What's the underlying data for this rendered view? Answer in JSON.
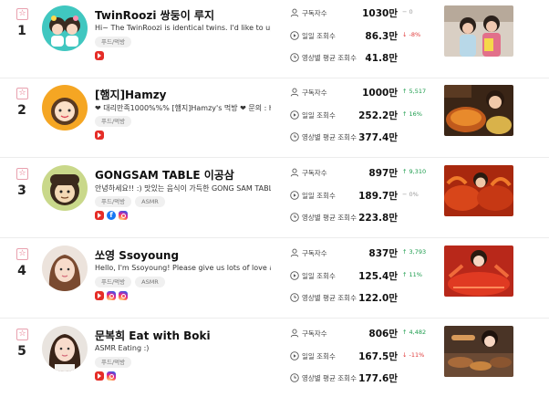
{
  "labels": {
    "subscribers": "구독자수",
    "daily_views": "일일 조회수",
    "avg_views": "영상별 평균 조회수"
  },
  "channels": [
    {
      "rank": "1",
      "name": "TwinRoozi 쌍둥이 루지",
      "desc": "Hi~ The TwinRoozi is identical twins. I'd like to uploa",
      "tags": [
        "푸드/먹방"
      ],
      "socials": [
        "youtube"
      ],
      "subscribers": "1030만",
      "subscribers_change": "0",
      "subscribers_trend": "flat",
      "daily_views": "86.3만",
      "daily_change": "-8%",
      "daily_trend": "down",
      "avg_views": "41.8만"
    },
    {
      "rank": "2",
      "name": "[햄지]Hamzy",
      "desc": "❤ 대리만족1000%%% [햄지]Hamzy's 먹방 ❤ 문의 : hjh",
      "tags": [
        "푸드/먹방"
      ],
      "socials": [
        "youtube"
      ],
      "subscribers": "1000만",
      "subscribers_change": "5,517",
      "subscribers_trend": "up",
      "daily_views": "252.2만",
      "daily_change": "16%",
      "daily_trend": "up",
      "avg_views": "377.4만"
    },
    {
      "rank": "3",
      "name": "GONGSAM TABLE 이공삼",
      "desc": "안녕하세요!! :) 맛있는 음식이 가득한 GONG SAM TABLE C",
      "tags": [
        "푸드/먹방",
        "ASMR"
      ],
      "socials": [
        "youtube",
        "facebook",
        "instagram"
      ],
      "subscribers": "897만",
      "subscribers_change": "9,310",
      "subscribers_trend": "up",
      "daily_views": "189.7만",
      "daily_change": "0%",
      "daily_trend": "flat",
      "avg_views": "223.8만"
    },
    {
      "rank": "4",
      "name": "쏘영 Ssoyoung",
      "desc": "Hello, I'm Ssoyoung! Please give us lots of love and s",
      "tags": [
        "푸드/먹방",
        "ASMR"
      ],
      "socials": [
        "youtube",
        "instagram",
        "instagram"
      ],
      "subscribers": "837만",
      "subscribers_change": "3,793",
      "subscribers_trend": "up",
      "daily_views": "125.4만",
      "daily_change": "11%",
      "daily_trend": "up",
      "avg_views": "122.0만"
    },
    {
      "rank": "5",
      "name": "문복희 Eat with Boki",
      "desc": "ASMR Eating :)",
      "tags": [
        "푸드/먹방"
      ],
      "socials": [
        "youtube",
        "instagram"
      ],
      "subscribers": "806만",
      "subscribers_change": "4,482",
      "subscribers_trend": "up",
      "daily_views": "167.5만",
      "daily_change": "-11%",
      "daily_trend": "down",
      "avg_views": "177.6만"
    }
  ]
}
